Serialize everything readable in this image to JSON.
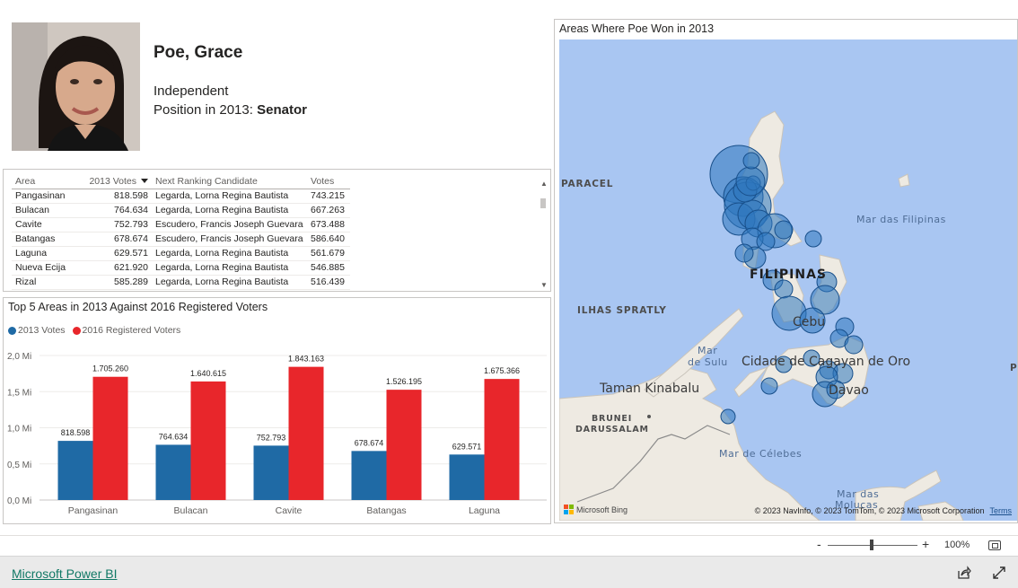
{
  "profile": {
    "name": "Poe, Grace",
    "party": "Independent",
    "position_label": "Position in 2013:",
    "position_value": "Senator"
  },
  "table": {
    "columns": [
      "Area",
      "2013 Votes",
      "Next Ranking Candidate",
      "Votes"
    ],
    "rows": [
      [
        "Pangasinan",
        "818.598",
        "Legarda, Lorna Regina Bautista",
        "743.215"
      ],
      [
        "Bulacan",
        "764.634",
        "Legarda, Lorna Regina Bautista",
        "667.263"
      ],
      [
        "Cavite",
        "752.793",
        "Escudero, Francis Joseph Guevara",
        "673.488"
      ],
      [
        "Batangas",
        "678.674",
        "Escudero, Francis Joseph Guevara",
        "586.640"
      ],
      [
        "Laguna",
        "629.571",
        "Legarda, Lorna Regina Bautista",
        "561.679"
      ],
      [
        "Nueva Ecija",
        "621.920",
        "Legarda, Lorna Regina Bautista",
        "546.885"
      ],
      [
        "Rizal",
        "585.289",
        "Legarda, Lorna Regina Bautista",
        "516.439"
      ]
    ]
  },
  "chart_data": {
    "type": "bar",
    "title": "Top 5 Areas in 2013 Against 2016 Registered Voters",
    "categories": [
      "Pangasinan",
      "Bulacan",
      "Cavite",
      "Batangas",
      "Laguna"
    ],
    "series": [
      {
        "name": "2013 Votes",
        "color": "#1f6aa5",
        "values": [
          818598,
          764634,
          752793,
          678674,
          629571
        ],
        "labels": [
          "818.598",
          "764.634",
          "752.793",
          "678.674",
          "629.571"
        ]
      },
      {
        "name": "2016 Registered Voters",
        "color": "#e8262b",
        "values": [
          1705260,
          1640615,
          1843163,
          1526195,
          1675366
        ],
        "labels": [
          "1.705.260",
          "1.640.615",
          "1.843.163",
          "1.526.195",
          "1.675.366"
        ]
      }
    ],
    "yticks": [
      "0,0 Mi",
      "0,5 Mi",
      "1,0 Mi",
      "1,5 Mi",
      "2,0 Mi"
    ],
    "ylim": [
      0,
      2000000
    ],
    "grid": true,
    "legend": "top-left"
  },
  "map": {
    "title": "Areas Where Poe Won in 2013",
    "labels": {
      "paracel": "PARACEL",
      "spratly": "ILHAS SPRATLY",
      "sulu_sea_1": "Mar",
      "sulu_sea_2": "de Sulu",
      "filipinas": "FILIPINAS",
      "mar_filipinas": "Mar das Filipinas",
      "cebu": "Cebu",
      "cagayan": "Cidade de Cagayan de Oro",
      "davao": "Davao",
      "kinabalu": "Taman Kinabalu",
      "brunei_1": "BRUNEI",
      "brunei_2": "DARUSSALAM",
      "celebes": "Mar de Célebes",
      "molucas_1": "Mar das",
      "molucas_2": "Molucas",
      "edge_p": "P"
    },
    "bing": "Microsoft Bing",
    "credits": "© 2023 NavInfo, © 2023 TomTom, © 2023 Microsoft Corporation",
    "terms": "Terms"
  },
  "zoom": {
    "minus": "-",
    "plus": "+",
    "percent": "100%"
  },
  "footer": {
    "link": "Microsoft Power BI"
  }
}
